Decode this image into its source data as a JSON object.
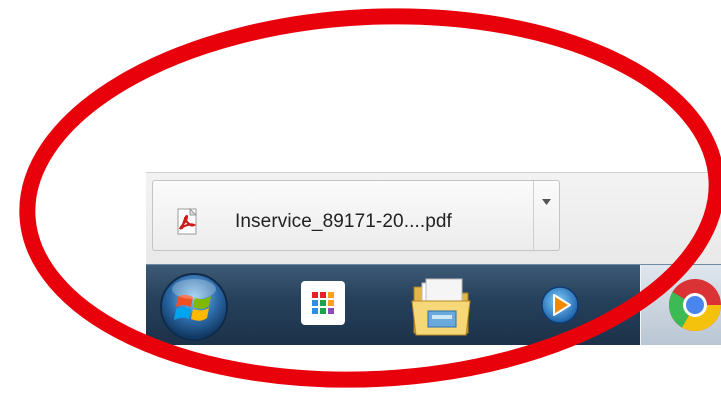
{
  "download_shelf": {
    "item": {
      "filename": "Inservice_89171-20....pdf",
      "icon": "pdf-icon",
      "menu_icon": "chevron-down-icon"
    }
  },
  "taskbar": {
    "buttons": [
      {
        "name": "start-orb",
        "icon": "windows-start-icon"
      },
      {
        "name": "apps",
        "icon": "apps-grid-icon"
      },
      {
        "name": "file-explorer",
        "icon": "folder-icon"
      },
      {
        "name": "media-player",
        "icon": "media-player-icon"
      },
      {
        "name": "chrome",
        "icon": "chrome-icon",
        "active": true
      }
    ]
  },
  "colors": {
    "annotation": "#e8000b",
    "taskbar": "#27425d",
    "shelf": "#eeeeee"
  }
}
